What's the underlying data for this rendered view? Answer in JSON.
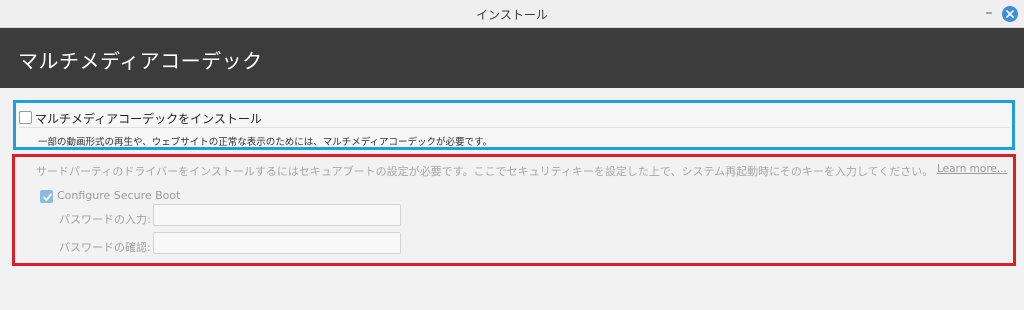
{
  "window": {
    "title": "インストール",
    "minimize_glyph": "–"
  },
  "header": {
    "title": "マルチメディアコーデック"
  },
  "codecs": {
    "checkbox_label": "マルチメディアコーデックをインストール",
    "checked": false,
    "description": "一部の動画形式の再生や、ウェブサイトの正常な表示のためには、マルチメディアコーデックが必要です。"
  },
  "secure_boot": {
    "info_text": "サードパーティのドライバーをインストールするにはセキュアブートの設定が必要です。ここでセキュリティキーを設定した上で、システム再起動時にそのキーを入力してください。",
    "learn_more": "Learn more...",
    "configure_label": "Configure Secure Boot",
    "configure_checked": true,
    "password_label": "パスワードの入力:",
    "password_value": "",
    "confirm_label": "パスワードの確認:",
    "confirm_value": ""
  },
  "colors": {
    "header_bg": "#3c3c3c",
    "highlight_blue": "#1ea0e0",
    "highlight_red": "#d9202a",
    "close_button": "#3d8fd8"
  },
  "icons": {
    "close": "close-icon",
    "minimize": "minimize-icon",
    "check": "check-icon"
  }
}
